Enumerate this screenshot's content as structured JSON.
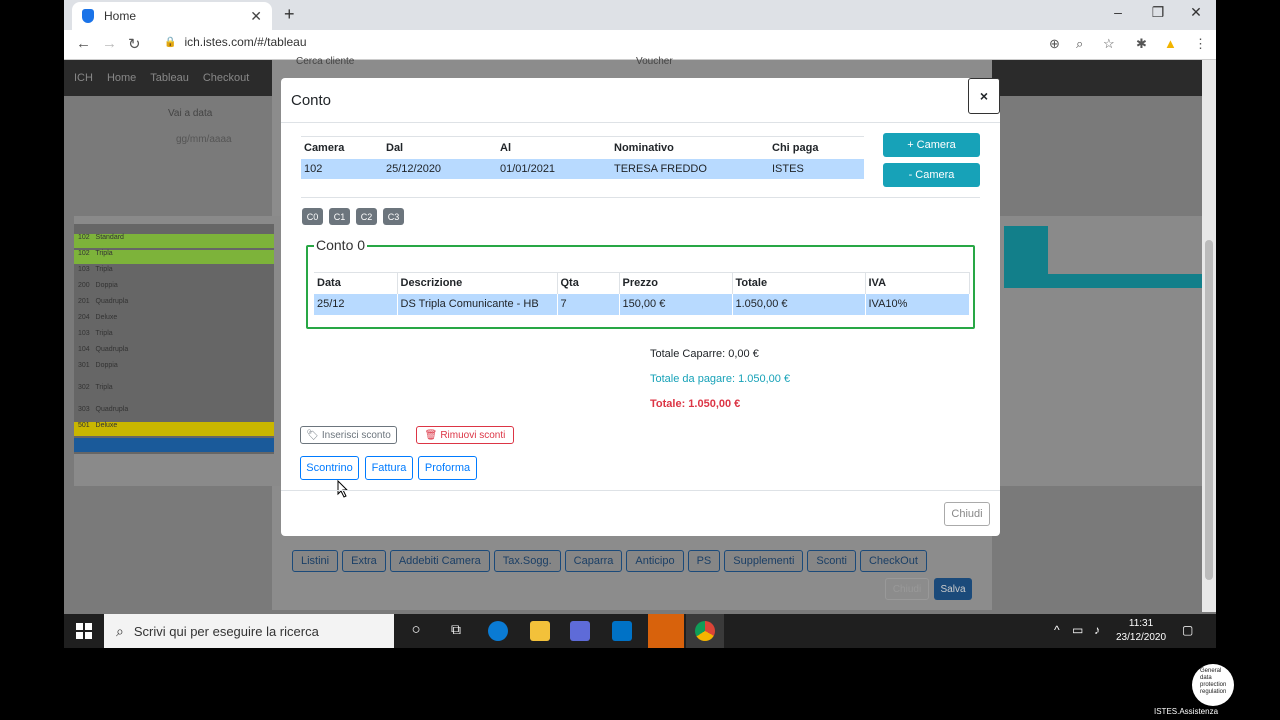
{
  "browser": {
    "tab_title": "Home",
    "url": "ich.istes.com/#/tableau",
    "window_controls": [
      "–",
      "❐",
      "✕"
    ]
  },
  "app_nav": [
    "ICH",
    "Home",
    "Tableau",
    "Checkout"
  ],
  "background_grid": {
    "vai_a_data": "Vai a data",
    "date_placeholder": "gg/mm/aaaa",
    "cerca_cliente": "Cerca cliente",
    "voucher": "Voucher",
    "room_rows": [
      {
        "num": "102",
        "type": "Standard"
      },
      {
        "num": "102",
        "type": "Tripla"
      },
      {
        "num": "103",
        "type": "Tripla"
      },
      {
        "num": "200",
        "type": "Doppia"
      },
      {
        "num": "201",
        "type": "Quadrupla"
      },
      {
        "num": "204",
        "type": "Deluxe"
      },
      {
        "num": "103",
        "type": "Tripla"
      },
      {
        "num": "104",
        "type": "Quadrupla"
      },
      {
        "num": "301",
        "type": "Doppia"
      },
      {
        "num": "302",
        "type": "Tripla"
      },
      {
        "num": "303",
        "type": "Quadrupla"
      },
      {
        "num": "501",
        "type": "Deluxe"
      }
    ],
    "bottom_buttons": [
      "Listini",
      "Extra",
      "Addebiti Camera",
      "Tax.Sogg.",
      "Caparra",
      "Anticipo",
      "PS",
      "Supplementi",
      "Sconti",
      "CheckOut"
    ],
    "chiudi": "Chiudi",
    "salva": "Salva"
  },
  "modal": {
    "title": "Conto",
    "close": "×",
    "camera_table": {
      "headers": [
        "Camera",
        "Dal",
        "Al",
        "Nominativo",
        "Chi paga"
      ],
      "rows": [
        [
          "102",
          "25/12/2020",
          "01/01/2021",
          "TERESA FREDDO",
          "ISTES"
        ]
      ]
    },
    "add_camera": "+ Camera",
    "remove_camera": "- Camera",
    "conto_tabs": [
      "C0",
      "C1",
      "C2",
      "C3"
    ],
    "conto_legend": "Conto 0",
    "conto_table": {
      "headers": [
        "Data",
        "Descrizione",
        "Qta",
        "Prezzo",
        "Totale",
        "IVA"
      ],
      "rows": [
        [
          "25/12",
          "DS Tripla Comunicante - HB",
          "7",
          "150,00 €",
          "1.050,00 €",
          "IVA10%"
        ]
      ]
    },
    "totale_caparre": "Totale Caparre: 0,00 €",
    "totale_da_pagare": "Totale da pagare: 1.050,00 €",
    "totale": "Totale: 1.050,00 €",
    "inserisci_sconto": "Inserisci sconto",
    "rimuovi_sconti": "Rimuovi sconti",
    "scontrino": "Scontrino",
    "fattura": "Fattura",
    "proforma": "Proforma",
    "chiudi": "Chiudi"
  },
  "taskbar": {
    "search_placeholder": "Scrivi qui per eseguire la ricerca",
    "time": "11:31",
    "date": "23/12/2020"
  },
  "overlay": {
    "gdpr_text": "General data protection regulation",
    "assist_label": "ISTES.Assistenza"
  },
  "colors": {
    "info": "#17a2b8",
    "success": "#28a745",
    "danger": "#dc3545",
    "primary": "#007bff",
    "selected_row": "#b8daff"
  }
}
